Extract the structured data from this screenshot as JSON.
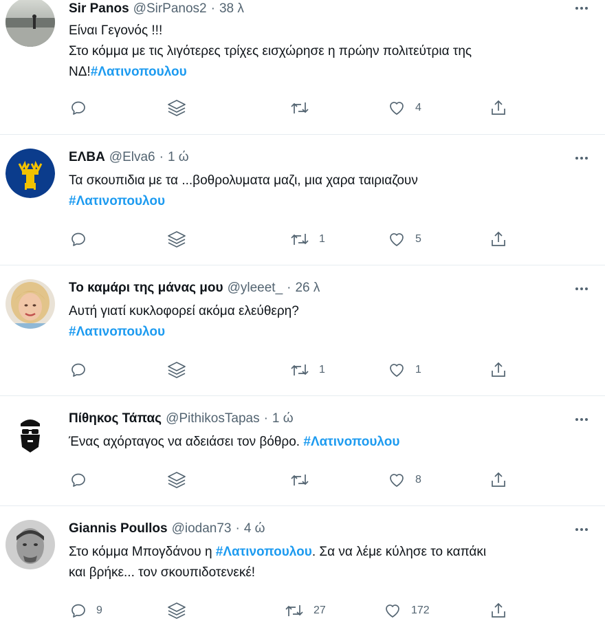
{
  "tweets": [
    {
      "name": "Sir Panos",
      "handle": "@SirPanos2",
      "time": "38 λ",
      "lines": [
        "Είναι Γεγονός !!!",
        "Στο κόμμα με τις λιγότερες τρίχες εισχώρησε  η πρώην πολιτεύτρια της"
      ],
      "last_prefix": "ΝΔ!",
      "hashtag": "#Λατινοπουλου",
      "last_suffix": "",
      "reply_count": "",
      "retweet_count": "",
      "like_count": "4"
    },
    {
      "name": "ΕΛΒΑ",
      "handle": "@Elva6",
      "time": "1 ώ",
      "lines": [
        "Τα σκουπιδια με τα ...βοθρολυματα μαζι, μια χαρα ταιριαζουν"
      ],
      "last_prefix": "",
      "hashtag": "#Λατινοπουλου",
      "last_suffix": "",
      "reply_count": "",
      "retweet_count": "1",
      "like_count": "5"
    },
    {
      "name": "Το καμάρι της μάνας μου",
      "handle": "@yleeet_",
      "time": "26 λ",
      "lines": [
        "Αυτή γιατί κυκλοφορεί ακόμα ελεύθερη?"
      ],
      "last_prefix": "",
      "hashtag": "#Λατινοπουλου",
      "last_suffix": "",
      "reply_count": "",
      "retweet_count": "1",
      "like_count": "1"
    },
    {
      "name": "Πίθηκος Τάπας",
      "handle": "@PithikosTapas",
      "time": "1 ώ",
      "lines": [],
      "last_prefix": "Ένας αχόρταγος να αδειάσει τον βόθρο. ",
      "hashtag": "#Λατινοπουλου",
      "last_suffix": "",
      "reply_count": "",
      "retweet_count": "",
      "like_count": "8"
    },
    {
      "name": "Giannis Poullos",
      "handle": "@iodan73",
      "time": "4 ώ",
      "lines": [],
      "last_prefix": "Στο κόμμα Μπογδάνου η ",
      "hashtag": "#Λατινοπουλου",
      "last_suffix": ". Σα να λέμε κύλησε το καπάκι",
      "extra_line": "και βρήκε... τον σκουπιδοτενεκέ!",
      "reply_count": "9",
      "retweet_count": "27",
      "like_count": "172"
    }
  ],
  "separator": "·",
  "colors": {
    "accent": "#1d9bf0",
    "icon": "#536471",
    "text": "#0f1419"
  },
  "icons": {
    "reply": "reply-icon",
    "share_layers": "layers-icon",
    "retweet": "retweet-icon",
    "like": "heart-icon",
    "share": "share-icon",
    "more": "more-dots-icon"
  }
}
